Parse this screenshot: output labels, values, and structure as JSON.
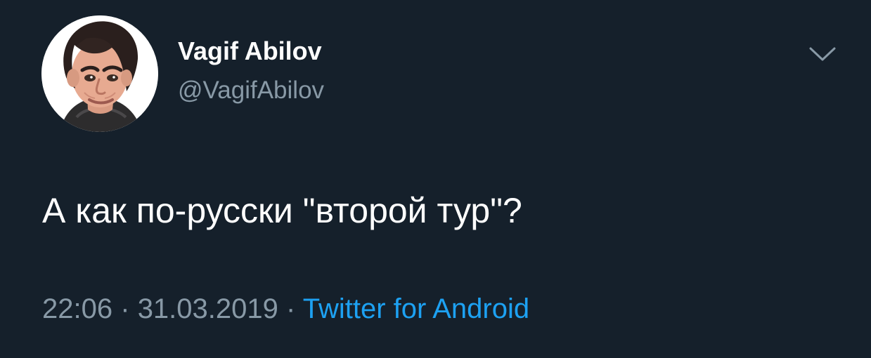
{
  "tweet": {
    "author_name": "Vagif Abilov",
    "author_handle": "@VagifAbilov",
    "text": "А как по-русски \"второй тур\"?",
    "time": "22:06",
    "separator": "·",
    "date": "31.03.2019",
    "source": "Twitter for Android"
  },
  "icons": {
    "avatar": "profile-avatar",
    "menu": "chevron-down-icon"
  },
  "colors": {
    "background": "#15202b",
    "primary_text": "#ffffff",
    "secondary_text": "#8899a6",
    "accent": "#1da1f2"
  }
}
